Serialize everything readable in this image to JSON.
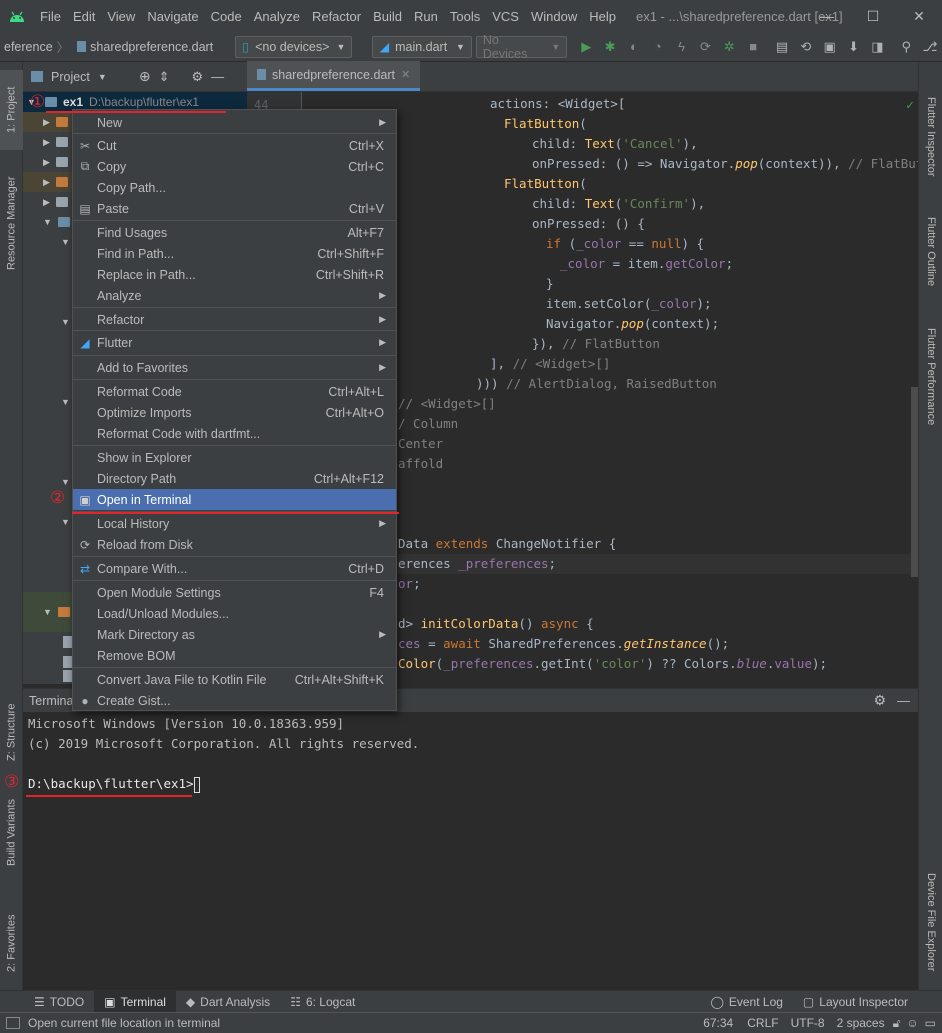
{
  "menubar": {
    "items": [
      "File",
      "Edit",
      "View",
      "Navigate",
      "Code",
      "Analyze",
      "Refactor",
      "Build",
      "Run",
      "Tools",
      "VCS",
      "Window",
      "Help"
    ],
    "title": "ex1 - ...\\sharedpreference.dart [ex1]",
    "controls": {
      "minimize": "—",
      "maximize": "☐",
      "close": "✕"
    }
  },
  "toolbar": {
    "breadcrumb_prefix": "eference",
    "breadcrumb_file": "sharedpreference.dart",
    "device_combo": "<no devices>",
    "run_config": "main.dart",
    "devices_combo": "No Devices"
  },
  "left_stripe": {
    "project": "1: Project",
    "resource_manager": "Resource Manager",
    "structure": "Z: Structure",
    "build_variants": "Build Variants",
    "favorites": "2: Favorites"
  },
  "right_stripe": {
    "flutter_inspector": "Flutter Inspector",
    "flutter_outline": "Flutter Outline",
    "flutter_performance": "Flutter Performance",
    "device_file_explorer": "Device File Explorer"
  },
  "project_panel": {
    "title": "Project",
    "root_name": "ex1",
    "root_path": "D:\\backup\\flutter\\ex1"
  },
  "editor": {
    "tab_label": "sharedpreference.dart",
    "first_line_number": "44",
    "lines": [
      {
        "t": "actions: <Widget>["
      },
      {
        "t": "FlatButton("
      },
      {
        "t": "child: Text('Cancel'),"
      },
      {
        "t": "onPressed: () => Navigator.pop(context)), // FlatButton"
      },
      {
        "t": "FlatButton("
      },
      {
        "t": "child: Text('Confirm'),"
      },
      {
        "t": "onPressed: () {"
      },
      {
        "t": "if (_color == null) {"
      },
      {
        "t": "_color = item.getColor;"
      },
      {
        "t": "}"
      },
      {
        "t": "item.setColor(_color);"
      },
      {
        "t": "Navigator.pop(context);"
      },
      {
        "t": "}), // FlatButton"
      },
      {
        "t": "], // <Widget>[]"
      },
      {
        "t": "))) // AlertDialog, RaisedButton"
      },
      {
        "t": "// <Widget>[]"
      },
      {
        "t": "/ Column"
      },
      {
        "t": "Center"
      },
      {
        "t": "affold"
      },
      {
        "t": "Data extends ChangeNotifier {"
      },
      {
        "t": "erences _preferences;"
      },
      {
        "t": "or;"
      },
      {
        "t": "d> initColorData() async {"
      },
      {
        "t": "ces = await SharedPreferences.getInstance();"
      },
      {
        "t": "Color(_preferences.getInt('color') ?? Colors.blue.value);"
      }
    ]
  },
  "context_menu": {
    "items": [
      {
        "label": "New",
        "shortcut": "",
        "submenu": true,
        "icon": ""
      },
      {
        "label": "Cut",
        "shortcut": "Ctrl+X",
        "submenu": false,
        "icon": "scissors-icon"
      },
      {
        "label": "Copy",
        "shortcut": "Ctrl+C",
        "submenu": false,
        "icon": "copy-icon"
      },
      {
        "label": "Copy Path...",
        "shortcut": "",
        "submenu": false,
        "icon": ""
      },
      {
        "label": "Paste",
        "shortcut": "Ctrl+V",
        "submenu": false,
        "icon": "paste-icon"
      },
      {
        "label": "Find Usages",
        "shortcut": "Alt+F7",
        "submenu": false,
        "icon": ""
      },
      {
        "label": "Find in Path...",
        "shortcut": "Ctrl+Shift+F",
        "submenu": false,
        "icon": ""
      },
      {
        "label": "Replace in Path...",
        "shortcut": "Ctrl+Shift+R",
        "submenu": false,
        "icon": ""
      },
      {
        "label": "Analyze",
        "shortcut": "",
        "submenu": true,
        "icon": ""
      },
      {
        "label": "Refactor",
        "shortcut": "",
        "submenu": true,
        "icon": ""
      },
      {
        "label": "Flutter",
        "shortcut": "",
        "submenu": true,
        "icon": "flutter-icon"
      },
      {
        "label": "Add to Favorites",
        "shortcut": "",
        "submenu": true,
        "icon": ""
      },
      {
        "label": "Reformat Code",
        "shortcut": "Ctrl+Alt+L",
        "submenu": false,
        "icon": ""
      },
      {
        "label": "Optimize Imports",
        "shortcut": "Ctrl+Alt+O",
        "submenu": false,
        "icon": ""
      },
      {
        "label": "Reformat Code with dartfmt...",
        "shortcut": "",
        "submenu": false,
        "icon": ""
      },
      {
        "label": "Show in Explorer",
        "shortcut": "",
        "submenu": false,
        "icon": ""
      },
      {
        "label": "Directory Path",
        "shortcut": "Ctrl+Alt+F12",
        "submenu": false,
        "icon": ""
      },
      {
        "label": "Open in Terminal",
        "shortcut": "",
        "submenu": false,
        "icon": "terminal-icon"
      },
      {
        "label": "Local History",
        "shortcut": "",
        "submenu": true,
        "icon": ""
      },
      {
        "label": "Reload from Disk",
        "shortcut": "",
        "submenu": false,
        "icon": "reload-icon"
      },
      {
        "label": "Compare With...",
        "shortcut": "Ctrl+D",
        "submenu": false,
        "icon": "compare-icon"
      },
      {
        "label": "Open Module Settings",
        "shortcut": "F4",
        "submenu": false,
        "icon": ""
      },
      {
        "label": "Load/Unload Modules...",
        "shortcut": "",
        "submenu": false,
        "icon": ""
      },
      {
        "label": "Mark Directory as",
        "shortcut": "",
        "submenu": true,
        "icon": ""
      },
      {
        "label": "Remove BOM",
        "shortcut": "",
        "submenu": false,
        "icon": ""
      },
      {
        "label": "Convert Java File to Kotlin File",
        "shortcut": "Ctrl+Alt+Shift+K",
        "submenu": false,
        "icon": ""
      },
      {
        "label": "Create Gist...",
        "shortcut": "",
        "submenu": false,
        "icon": "github-icon"
      }
    ]
  },
  "terminal": {
    "title": "Termina",
    "lines": [
      "Microsoft Windows [Version 10.0.18363.959]",
      "(c) 2019 Microsoft Corporation. All rights reserved.",
      "",
      "D:\\backup\\flutter\\ex1>"
    ]
  },
  "annotations": {
    "one": "①",
    "two": "②",
    "three": "③"
  },
  "bottom_tabs": [
    "TODO",
    "Terminal",
    "Dart Analysis",
    "6: Logcat"
  ],
  "bottom_right_tabs": [
    "Event Log",
    "Layout Inspector"
  ],
  "status": {
    "message": "Open current file location in terminal",
    "position": "67:34",
    "line_sep": "CRLF",
    "encoding": "UTF-8",
    "indent": "2 spaces"
  },
  "colors": {
    "accent": "#4b6eaf",
    "annotation_red": "#e0262c",
    "background": "#2b2b2b",
    "panel": "#3c3f41"
  }
}
